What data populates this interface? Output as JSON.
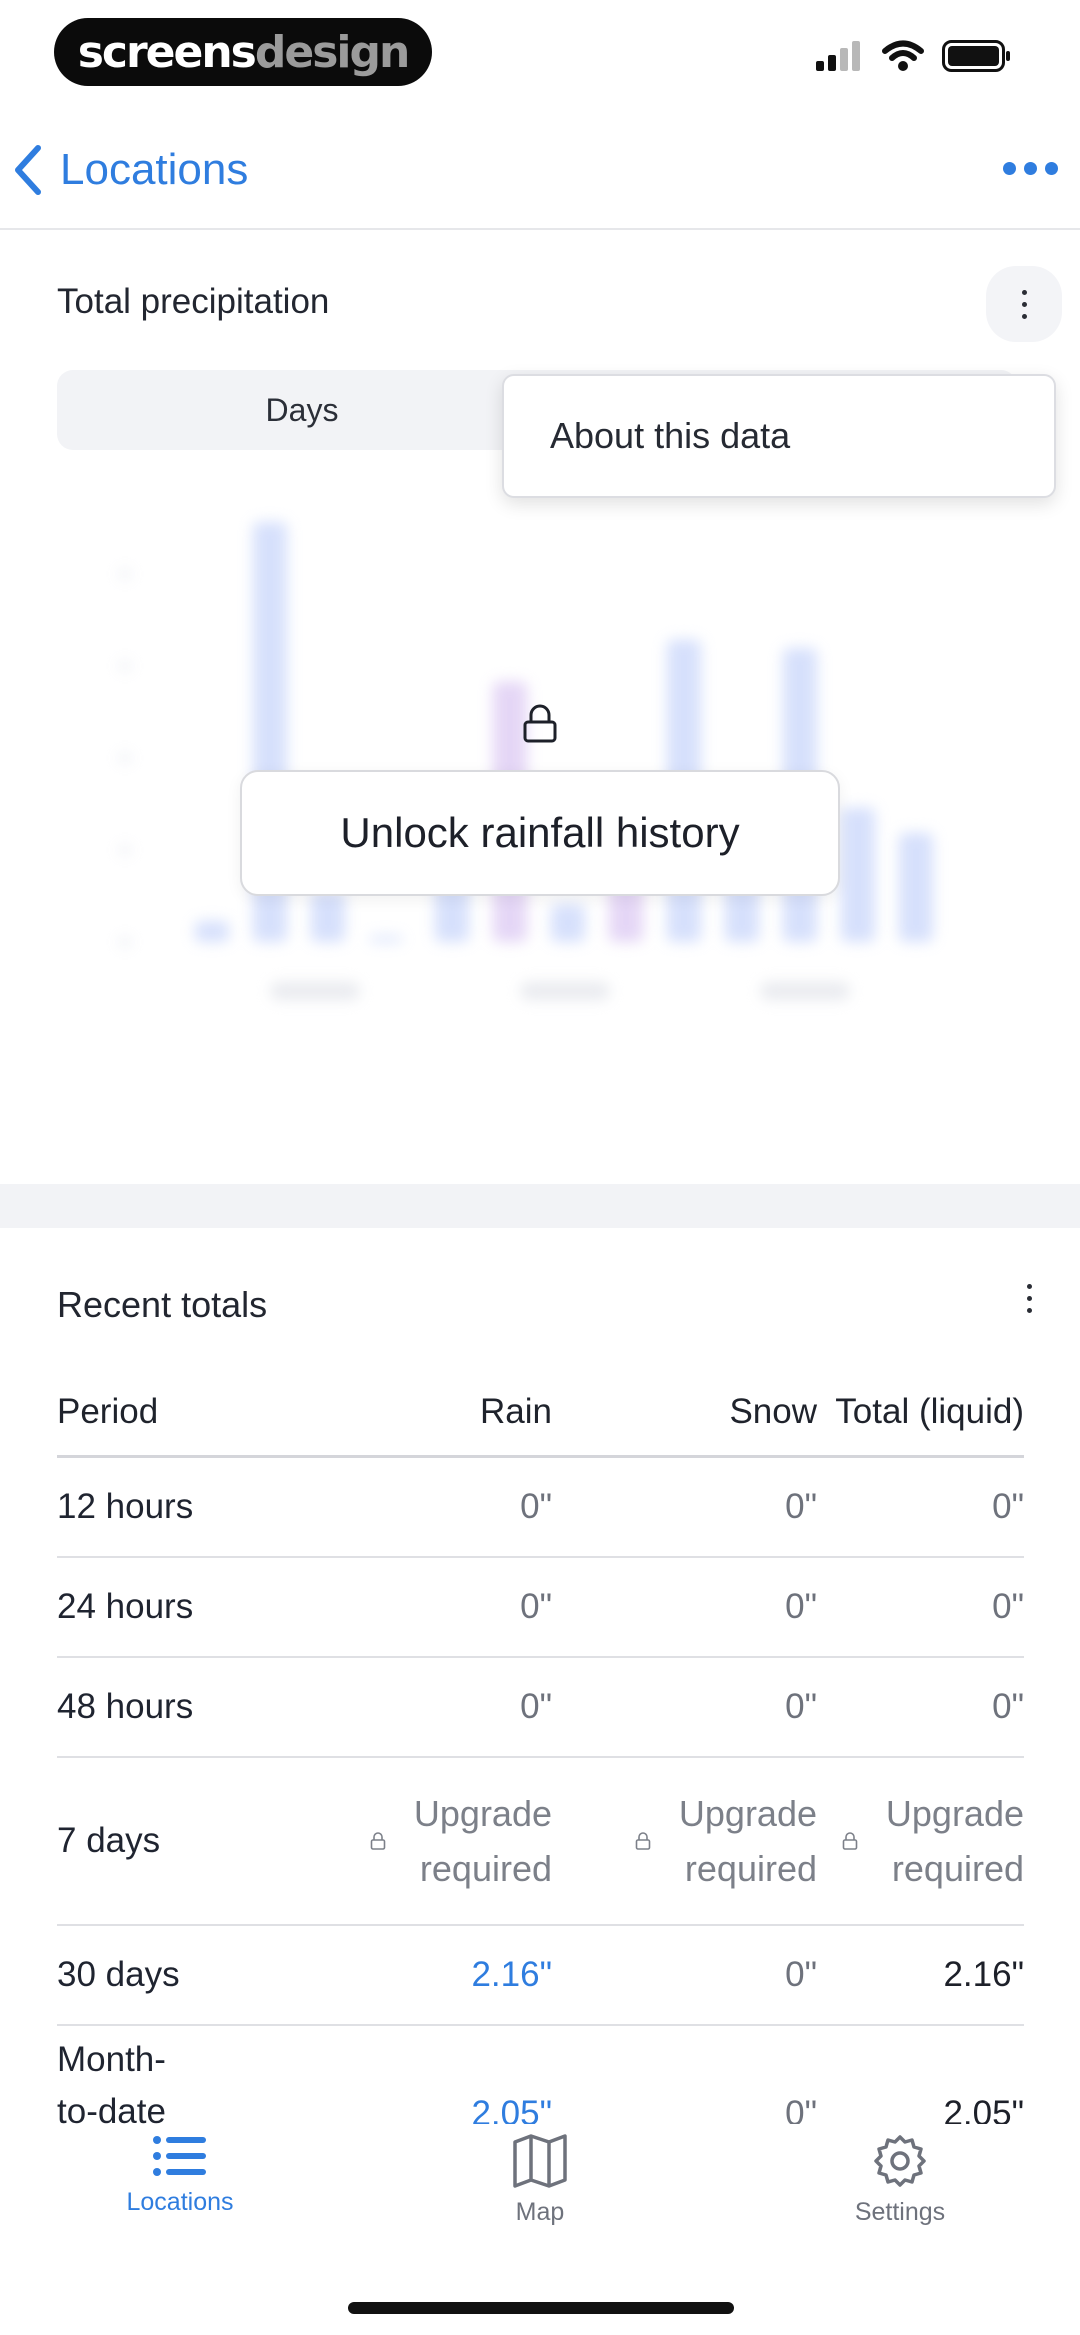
{
  "status_bar": {
    "brand_part1": "screens",
    "brand_part2": "design"
  },
  "nav": {
    "back_label": "Locations"
  },
  "precipitation": {
    "title": "Total precipitation",
    "segment_selected": "Days",
    "menu_item": "About this data",
    "unlock_label": "Unlock rainfall history",
    "chart_data": {
      "type": "bar",
      "values": [
        0.05,
        1.0,
        0.12,
        0.01,
        0.3,
        0.62,
        0.09,
        0.3,
        0.72,
        0.28,
        0.7,
        0.32,
        0.26
      ],
      "blurred": true
    }
  },
  "recent_totals": {
    "title": "Recent totals",
    "columns": [
      "Period",
      "Rain",
      "Snow",
      "Total (liquid)"
    ],
    "rows": [
      {
        "period": "12 hours",
        "rain": "0\"",
        "snow": "0\"",
        "total": "0\""
      },
      {
        "period": "24 hours",
        "rain": "0\"",
        "snow": "0\"",
        "total": "0\""
      },
      {
        "period": "48 hours",
        "rain": "0\"",
        "snow": "0\"",
        "total": "0\""
      },
      {
        "period": "7 days",
        "rain": "Upgrade required",
        "snow": "Upgrade required",
        "total": "Upgrade required"
      },
      {
        "period": "30 days",
        "rain": "2.16\"",
        "snow": "0\"",
        "total": "2.16\""
      },
      {
        "period": "Month-to-date",
        "rain": "2.05\"",
        "snow": "0\"",
        "total": "2.05\""
      }
    ],
    "upgrade_line1": "Upgrade",
    "upgrade_line2": "required"
  },
  "tabs": [
    {
      "label": "Locations",
      "icon": "list-icon",
      "active": true
    },
    {
      "label": "Map",
      "icon": "map-icon",
      "active": false
    },
    {
      "label": "Settings",
      "icon": "gear-icon",
      "active": false
    }
  ],
  "colors": {
    "accent": "#2f7ddf",
    "bar_blue": "#c9d6fb",
    "bar_purple": "#dcc9f3"
  }
}
